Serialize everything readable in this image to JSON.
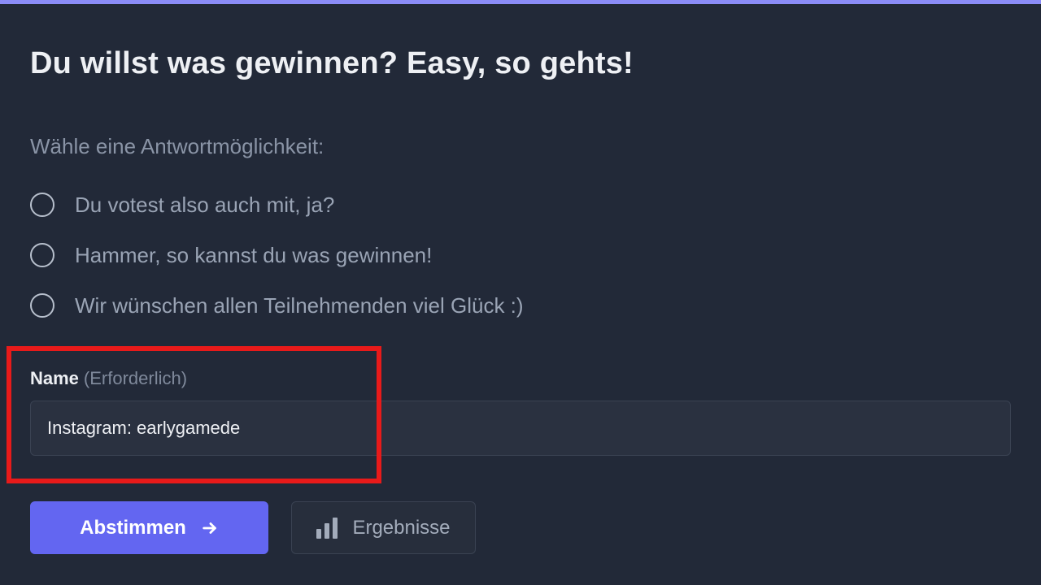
{
  "poll": {
    "title": "Du willst was gewinnen? Easy, so gehts!",
    "prompt": "Wähle eine Antwortmöglichkeit:",
    "options": [
      {
        "label": "Du votest also auch mit, ja?"
      },
      {
        "label": "Hammer, so kannst du was gewinnen!"
      },
      {
        "label": "Wir wünschen allen Teilnehmenden viel Glück :)"
      }
    ]
  },
  "form": {
    "name_label": "Name",
    "name_required": "(Erforderlich)",
    "name_value": "Instagram: earlygamede"
  },
  "actions": {
    "vote_label": "Abstimmen",
    "vote_icon": "arrow-right-icon",
    "results_label": "Ergebnisse",
    "results_icon": "bar-chart-icon"
  },
  "colors": {
    "accent": "#6366f1",
    "background": "#222938",
    "highlight": "#e81a1a"
  }
}
